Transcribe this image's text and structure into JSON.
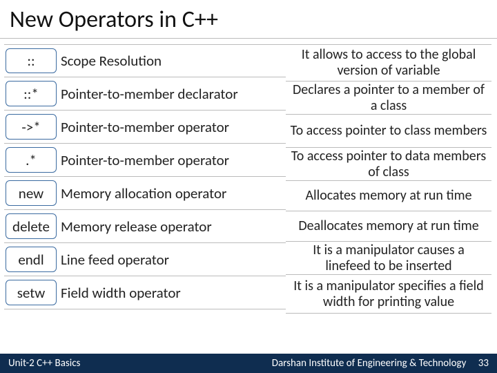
{
  "title": "New Operators in C++",
  "operators": [
    {
      "symbol": "::",
      "name": "Scope Resolution"
    },
    {
      "symbol": "::*",
      "name": "Pointer-to-member declarator"
    },
    {
      "symbol": "->*",
      "name": "Pointer-to-member operator"
    },
    {
      "symbol": ".*",
      "name": "Pointer-to-member operator"
    },
    {
      "symbol": "new",
      "name": "Memory allocation operator"
    },
    {
      "symbol": "delete",
      "name": "Memory release operator"
    },
    {
      "symbol": "endl",
      "name": "Line feed operator"
    },
    {
      "symbol": "setw",
      "name": "Field width operator"
    }
  ],
  "descriptions": [
    "It allows to access to the global version of variable",
    "Declares a pointer to a member of a class",
    "To access pointer to class members",
    "To access pointer to data members of class",
    "Allocates memory at run time",
    "Deallocates memory at run time",
    "It is a manipulator causes a linefeed to be inserted",
    "It is a manipulator specifies a field width for printing value"
  ],
  "footer": {
    "left": "Unit-2 C++ Basics",
    "right": "Darshan Institute of Engineering & Technology",
    "page": "33"
  }
}
